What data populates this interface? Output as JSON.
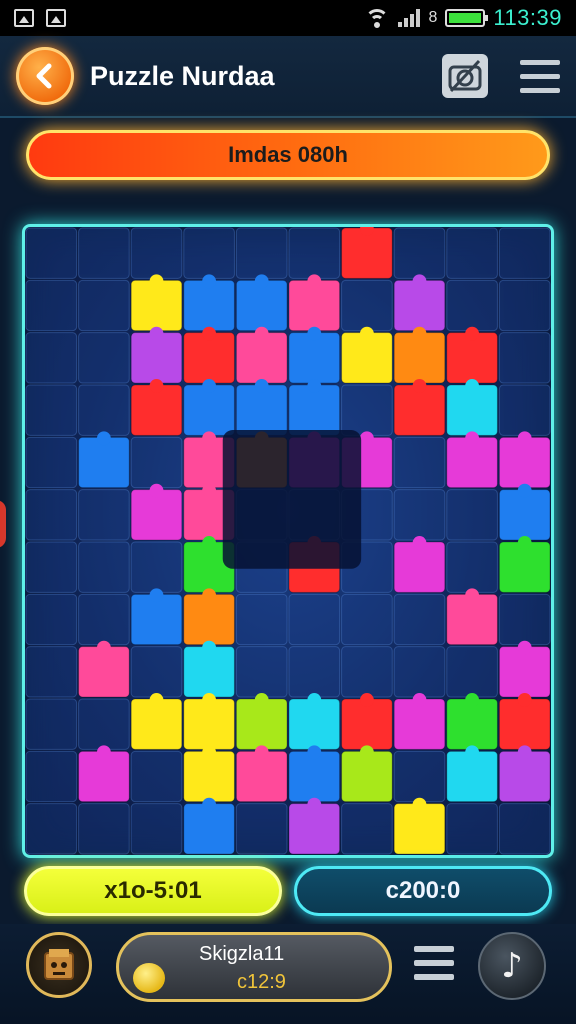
{
  "status_bar": {
    "time": "113:39",
    "battery_level": 1.0,
    "battery_color": "#3ce03c",
    "icons": [
      "gallery-icon",
      "image-icon",
      "wifi-icon",
      "signal-icon",
      "battery-icon"
    ]
  },
  "header": {
    "title": "Puzzle Nurdaa",
    "back_icon": "chevron-left-icon",
    "camera_icon": "no-camera-icon",
    "menu_icon": "hamburger-icon"
  },
  "progress": {
    "label": "Imdas 080h",
    "colors": [
      "#ff3a10",
      "#ff9a1a"
    ]
  },
  "board": {
    "background": "#0f2456",
    "border_color": "#5ff0e8",
    "piece_colors": [
      "#2ee02e",
      "#ffe91a",
      "#ff2d2d",
      "#20d8f0",
      "#e63ad8",
      "#ff8a12",
      "#1f7ef0",
      "#b84ae8",
      "#a8e81a",
      "#ff4a9a"
    ]
  },
  "stats": {
    "left": "x1o-5:01",
    "right": "c200:0",
    "left_color": "#e6ff30",
    "right_color": "#26c8df"
  },
  "player": {
    "name": "Skigzla11",
    "score": "c12:9",
    "avatar_icon": "box-character-icon",
    "coin_icon": "coin-icon"
  },
  "bottom_bar": {
    "menu_icon": "hamburger-icon",
    "music_icon": "music-note-icon",
    "music_glyph": "♪"
  }
}
